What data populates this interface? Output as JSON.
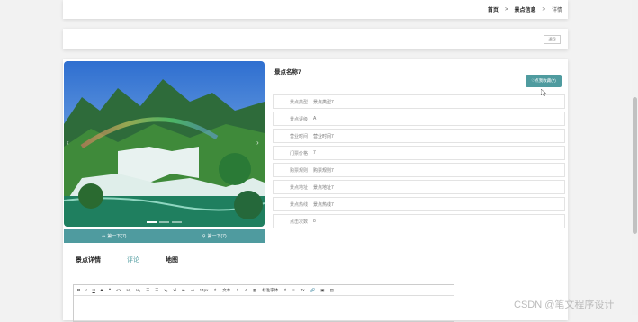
{
  "breadcrumb": {
    "home": "首页",
    "sep1": ">",
    "section": "景点信息",
    "sep2": ">",
    "current": "详情"
  },
  "toolbar": {
    "back_label": "返回"
  },
  "spot": {
    "title": "景点名称7",
    "favorite_label": "点我收藏(7)",
    "fields": [
      {
        "key": "景点类型",
        "value": "景点类型7"
      },
      {
        "key": "景点评级",
        "value": "A"
      },
      {
        "key": "营业时间",
        "value": "营业时间7"
      },
      {
        "key": "门票价格",
        "value": "7"
      },
      {
        "key": "购票规则",
        "value": "购票规则7"
      },
      {
        "key": "景点地址",
        "value": "景点地址7"
      },
      {
        "key": "景点热线",
        "value": "景点热线7"
      },
      {
        "key": "点击次数",
        "value": "8"
      }
    ]
  },
  "carousel": {
    "prev_label": "第一下(7)",
    "next_label": "第一下(7)",
    "prev_arrow": "‹",
    "next_arrow": "›"
  },
  "tabs": [
    {
      "label": "景点详情"
    },
    {
      "label": "评论"
    },
    {
      "label": "地图"
    }
  ],
  "editor": {
    "toolbar": [
      "B",
      "I",
      "U",
      "S",
      "❝",
      "<>",
      "H₁",
      "H₂",
      "☰",
      "☷",
      "x₂",
      "x²",
      "⇤",
      "⇥",
      "14px",
      "⇕",
      "文本",
      "⇕",
      "A",
      "▦",
      "标准字体",
      "⇕",
      "≡",
      "Tx",
      "🔗",
      "▣",
      "▤"
    ]
  },
  "watermark": "CSDN @笔文程序设计"
}
